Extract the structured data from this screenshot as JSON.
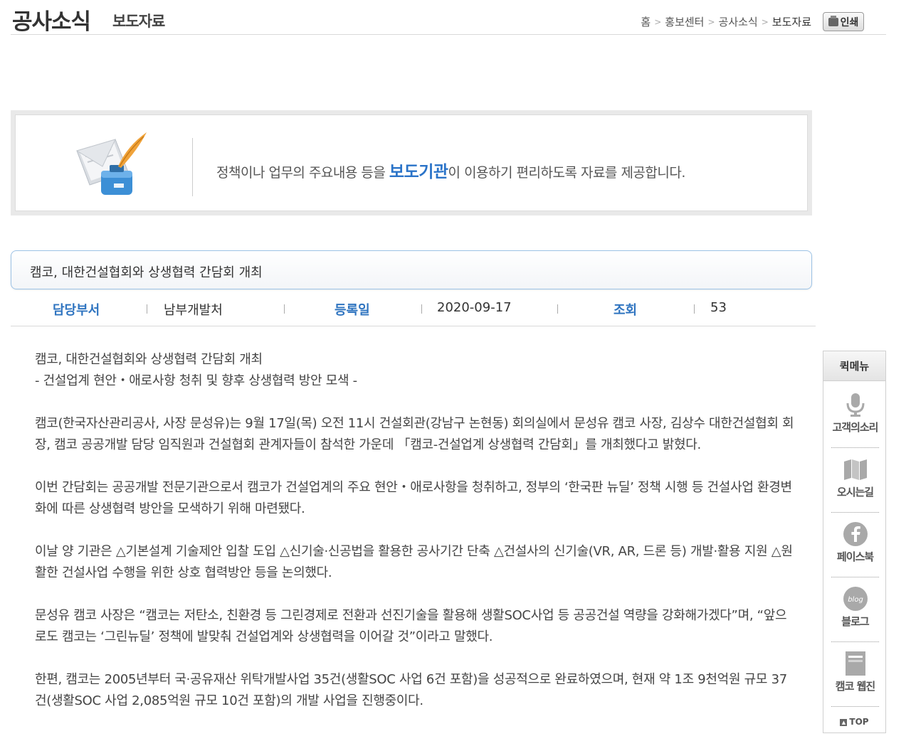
{
  "header": {
    "title": "공사소식",
    "subtitle": "보도자료",
    "breadcrumb": [
      "홈",
      "홍보센터",
      "공사소식",
      "보도자료"
    ],
    "print_label": "인쇄"
  },
  "banner": {
    "text_before": "정책이나 업무의 주요내용 등을 ",
    "text_highlight": "보도기관",
    "text_after": "이 이용하기 편리하도록 자료를 제공합니다."
  },
  "article": {
    "title": "캠코, 대한건설협회와 상생협력 간담회 개최",
    "meta": {
      "dept_label": "담당부서",
      "dept_value": "남부개발처",
      "date_label": "등록일",
      "date_value": "2020-09-17",
      "views_label": "조회",
      "views_value": "53"
    },
    "headline": "캠코, 대한건설협회와 상생협력 간담회 개최",
    "subheadline": "- 건설업계 현안・애로사항 청취 및 향후 상생협력 방안 모색 -",
    "paragraphs": [
      "캠코(한국자산관리공사, 사장 문성유)는 9월 17일(목) 오전 11시 건설회관(강남구 논현동) 회의실에서 문성유 캠코 사장, 김상수 대한건설협회 회장, 캠코 공공개발 담당 임직원과 건설협회 관계자들이 참석한 가운데 「캠코-건설업계 상생협력 간담회」를 개최했다고 밝혔다.",
      "이번 간담회는 공공개발 전문기관으로서 캠코가 건설업계의 주요 현안・애로사항을 청취하고, 정부의 ‘한국판 뉴딜’ 정책 시행 등 건설사업 환경변화에 따른 상생협력 방안을 모색하기 위해 마련됐다.",
      "이날 양 기관은 △기본설계 기술제안 입찰 도입 △신기술·신공법을 활용한 공사기간 단축 △건설사의 신기술(VR, AR, 드론 등) 개발·활용 지원 △원활한 건설사업 수행을 위한 상호 협력방안 등을 논의했다.",
      "문성유 캠코 사장은 “캠코는 저탄소, 친환경 등 그린경제로 전환과 선진기술을 활용해 생활SOC사업 등 공공건설 역량을 강화해가겠다”며, “앞으로도 캠코는 ‘그린뉴딜’ 정책에 발맞춰 건설업계와 상생협력을 이어갈 것”이라고 말했다.",
      "한편, 캠코는 2005년부터 국·공유재산 위탁개발사업 35건(생활SOC 사업 6건 포함)을 성공적으로 완료하였으며, 현재 약 1조 9천억원 규모 37건(생활SOC 사업 2,085억원 규모 10건 포함)의 개발 사업을 진행중이다."
    ]
  },
  "quick_menu": {
    "title": "퀵메뉴",
    "items": [
      {
        "label": "고객의소리",
        "icon": "microphone-icon"
      },
      {
        "label": "오시는길",
        "icon": "map-icon"
      },
      {
        "label": "페이스북",
        "icon": "facebook-icon"
      },
      {
        "label": "블로그",
        "icon": "blog-icon"
      },
      {
        "label": "캠코 웹진",
        "icon": "book-icon"
      }
    ],
    "top_label": "TOP"
  }
}
